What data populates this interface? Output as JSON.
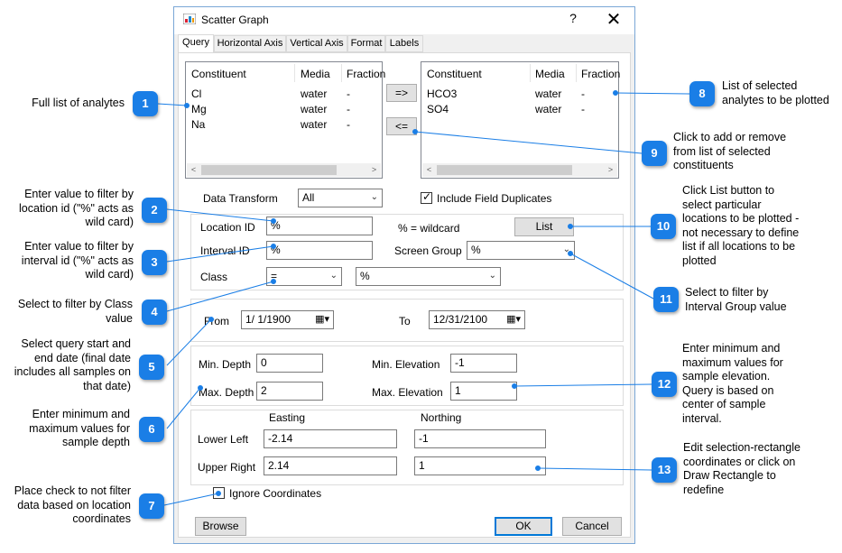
{
  "window": {
    "title": "Scatter Graph",
    "help": "?",
    "close": "✕"
  },
  "tabs": [
    "Query",
    "Horizontal Axis",
    "Vertical Axis",
    "Format",
    "Labels"
  ],
  "available_list": {
    "headers": [
      "Constituent",
      "Media",
      "Fraction"
    ],
    "rows": [
      [
        "Cl",
        "water",
        "-"
      ],
      [
        "Mg",
        "water",
        "-"
      ],
      [
        "Na",
        "water",
        "-"
      ]
    ]
  },
  "selected_list": {
    "headers": [
      "Constituent",
      "Media",
      "Fraction"
    ],
    "rows": [
      [
        "HCO3",
        "water",
        "-"
      ],
      [
        "SO4",
        "water",
        "-"
      ]
    ]
  },
  "buttons": {
    "add": "=>",
    "remove": "<=",
    "list": "List",
    "browse": "Browse",
    "ok": "OK",
    "cancel": "Cancel"
  },
  "scroll": {
    "left": "<",
    "right": ">"
  },
  "data_transform": {
    "label": "Data Transform",
    "value": "All"
  },
  "include_field_duplicates": {
    "label": "Include Field Duplicates",
    "checked": true
  },
  "location": {
    "label": "Location ID",
    "value": "%",
    "hint": "% = wildcard"
  },
  "interval": {
    "label": "Interval ID",
    "value": "%"
  },
  "screen_group": {
    "label": "Screen Group",
    "value": "%"
  },
  "class": {
    "label": "Class",
    "operator": "=",
    "value": "%"
  },
  "dates": {
    "from_label": "From",
    "from_value": "1/ 1/1900",
    "to_label": "To",
    "to_value": "12/31/2100"
  },
  "depth": {
    "min_label": "Min. Depth",
    "min_value": "0",
    "max_label": "Max. Depth",
    "max_value": "2"
  },
  "elevation": {
    "min_label": "Min. Elevation",
    "min_value": "-1",
    "max_label": "Max. Elevation",
    "max_value": "1"
  },
  "coords": {
    "easting_label": "Easting",
    "northing_label": "Northing",
    "lower_left_label": "Lower Left",
    "ll_easting": "-2.14",
    "ll_northing": "-1",
    "upper_right_label": "Upper Right",
    "ur_easting": "2.14",
    "ur_northing": "1"
  },
  "ignore_coordinates": {
    "label": "Ignore Coordinates",
    "checked": false
  },
  "callouts": [
    {
      "num": "1",
      "lines": [
        "Full list of analytes"
      ]
    },
    {
      "num": "2",
      "lines": [
        "Enter value to filter by",
        "location id (\"%\" acts as",
        "wild card)"
      ]
    },
    {
      "num": "3",
      "lines": [
        "Enter value to filter by",
        "interval id (\"%\" acts as",
        "wild card)"
      ]
    },
    {
      "num": "4",
      "lines": [
        "Select to filter by Class",
        "value"
      ]
    },
    {
      "num": "5",
      "lines": [
        "Select query start and",
        "end date (final date",
        "includes all samples on",
        "that date)"
      ]
    },
    {
      "num": "6",
      "lines": [
        "Enter minimum and",
        "maximum values for",
        "sample depth"
      ]
    },
    {
      "num": "7",
      "lines": [
        "Place check to not filter",
        "data based on location",
        "coordinates"
      ]
    },
    {
      "num": "8",
      "lines": [
        "List of selected",
        "analytes to be plotted"
      ]
    },
    {
      "num": "9",
      "lines": [
        "Click to add or remove",
        "from list of selected",
        "constituents"
      ]
    },
    {
      "num": "10",
      "lines": [
        "Click List button to",
        "select particular",
        "locations to be plotted -",
        "not necessary to define",
        "list if all locations to be",
        "plotted"
      ]
    },
    {
      "num": "11",
      "lines": [
        "Select to filter by",
        "Interval Group value"
      ]
    },
    {
      "num": "12",
      "lines": [
        "Enter minimum and",
        "maximum values for",
        "sample elevation.",
        "Query is based on",
        "center of sample",
        "interval."
      ]
    },
    {
      "num": "13",
      "lines": [
        "Edit selection-rectangle",
        "coordinates or click on",
        "Draw Rectangle to",
        "redefine"
      ]
    }
  ]
}
